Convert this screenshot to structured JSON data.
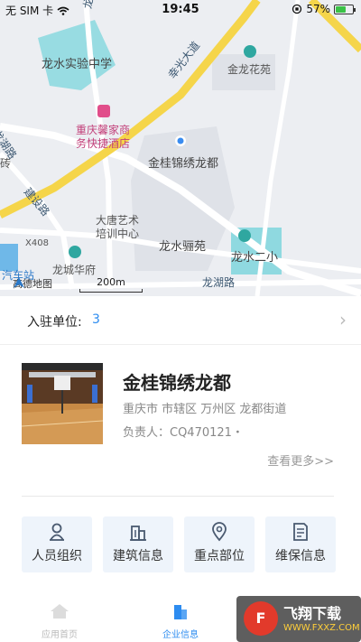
{
  "status_bar": {
    "carrier": "无 SIM 卡",
    "time": "19:45",
    "battery": "57%"
  },
  "map": {
    "labels": {
      "longwang_road": "龙王路",
      "school": "龙水实验中学",
      "xingguang_road": "幸光大道",
      "jinlong_garden": "金龙花苑",
      "longhu_road_left": "龙湖路",
      "hotel_line1": "重庆馨家商",
      "hotel_line2": "务快捷酒店",
      "brick": "砖",
      "jingui": "金桂锦绣龙都",
      "jianshe_road": "建设路",
      "datang_line1": "大唐艺术",
      "datang_line2": "培训中心",
      "longshui_liyuan": "龙水骊苑",
      "longshui_erxiao": "龙水二小",
      "x408": "X408",
      "longcheng": "龙城华府",
      "bus_station": "汽车站",
      "longhu_road_bottom": "龙湖路"
    },
    "amap_logo": "高德地图",
    "scale": "200m"
  },
  "summary": {
    "label": "入驻单位:",
    "value": "3"
  },
  "enterprise": {
    "name": "金桂锦绣龙都",
    "address": "重庆市 市辖区 万州区 龙都街道",
    "responsible": "负责人：CQ470121・",
    "more": "查看更多>>"
  },
  "actions": [
    {
      "label": "人员组织",
      "icon": "people-icon"
    },
    {
      "label": "建筑信息",
      "icon": "building-icon"
    },
    {
      "label": "重点部位",
      "icon": "location-pin-icon"
    },
    {
      "label": "维保信息",
      "icon": "document-icon"
    }
  ],
  "tabs": [
    {
      "label": "应用首页",
      "active": false
    },
    {
      "label": "企业信息",
      "active": true
    }
  ],
  "watermark": {
    "name": "飞翔下载",
    "url": "WWW.FXXZ.COM"
  },
  "colors": {
    "accent": "#2d8cf0",
    "road_yellow": "#f5d54a",
    "water": "#8fd9e0"
  }
}
